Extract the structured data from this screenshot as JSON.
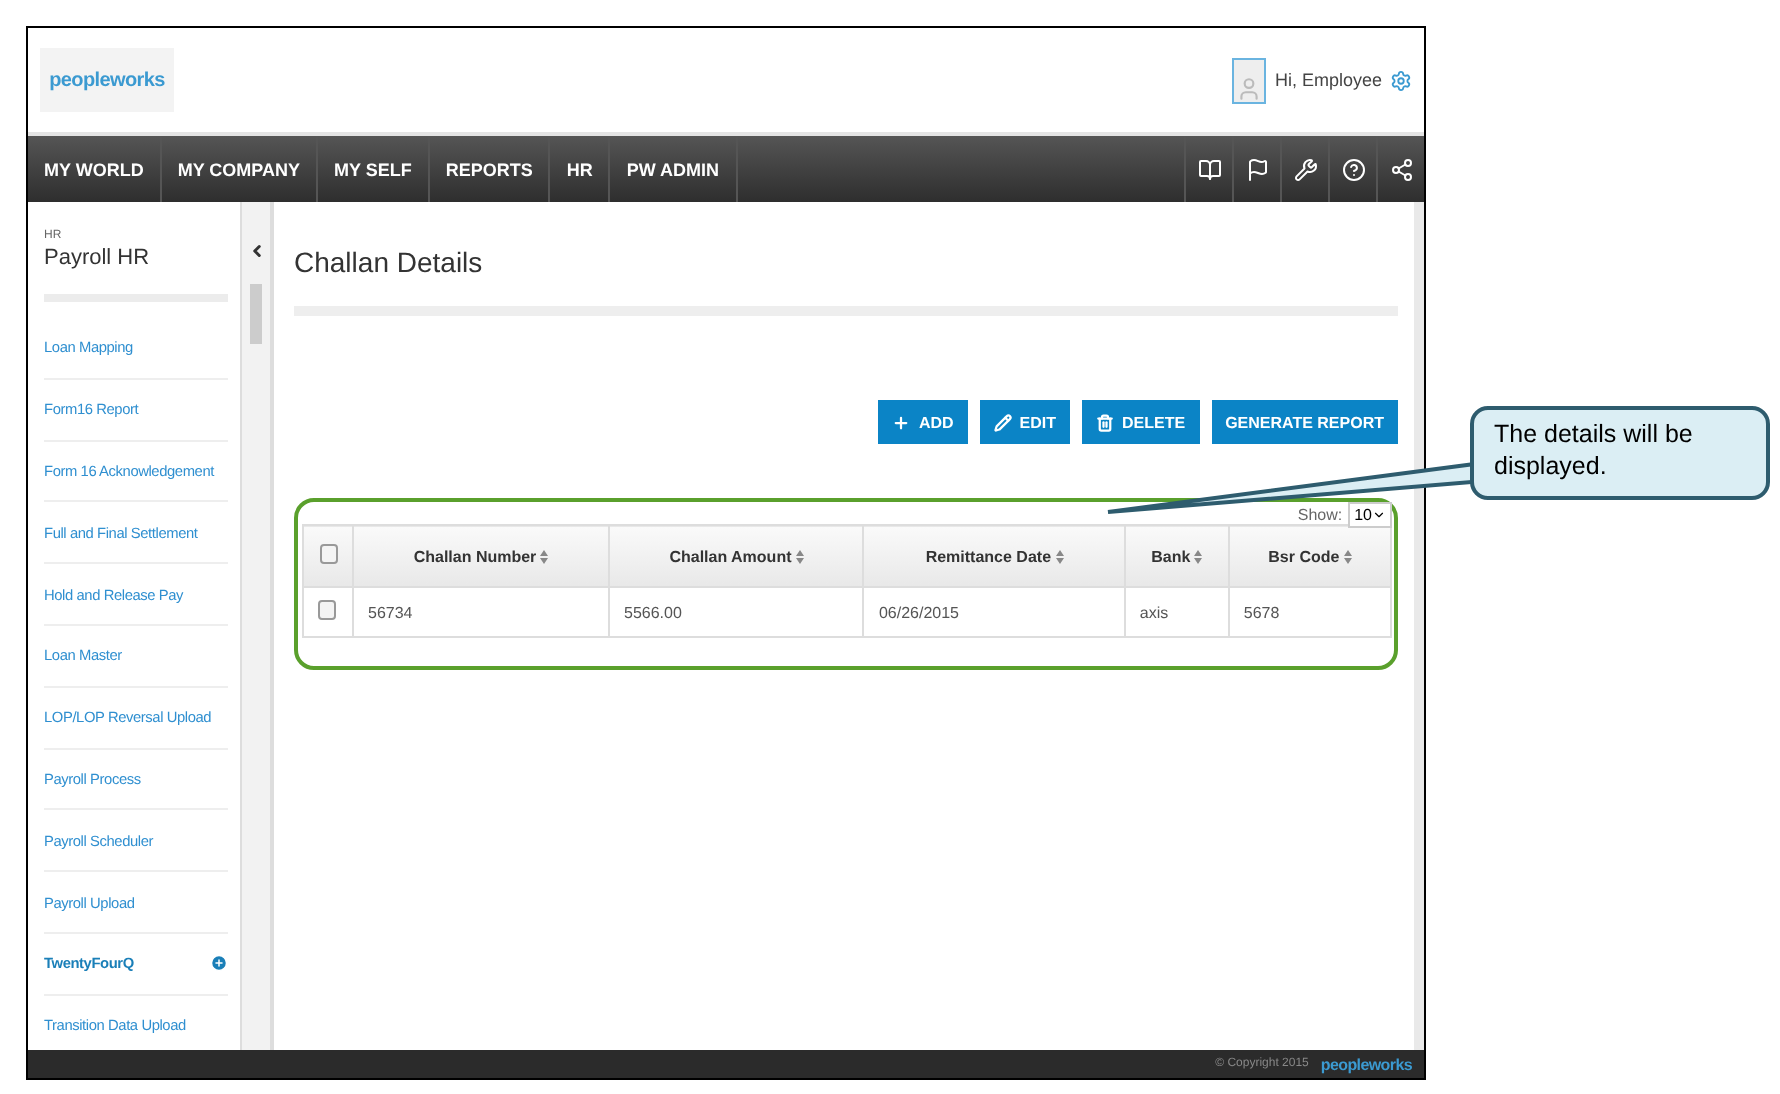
{
  "header": {
    "logo": "peopleworks",
    "greeting": "Hi, Employee"
  },
  "nav": {
    "items": [
      {
        "label": "MY WORLD",
        "selected": false
      },
      {
        "label": "MY COMPANY",
        "selected": false
      },
      {
        "label": "MY SELF",
        "selected": false
      },
      {
        "label": "REPORTS",
        "selected": false
      },
      {
        "label": "HR",
        "selected": false
      },
      {
        "label": "PW ADMIN",
        "selected": false
      }
    ],
    "tools": [
      {
        "kind": "book"
      },
      {
        "kind": "flag"
      },
      {
        "kind": "tools"
      },
      {
        "kind": "help"
      },
      {
        "kind": "share"
      }
    ]
  },
  "sidebar": {
    "section": "HR",
    "title": "Payroll HR",
    "items": [
      {
        "label": "Loan Mapping",
        "selected": false
      },
      {
        "label": "Form16 Report",
        "selected": false
      },
      {
        "label": "Form 16 Acknowledgement",
        "selected": false
      },
      {
        "label": "Full and Final Settlement",
        "selected": false
      },
      {
        "label": "Hold and Release Pay",
        "selected": false
      },
      {
        "label": "Loan Master",
        "selected": false
      },
      {
        "label": "LOP/LOP Reversal Upload",
        "selected": false
      },
      {
        "label": "Payroll Process",
        "selected": false
      },
      {
        "label": "Payroll Scheduler",
        "selected": false
      },
      {
        "label": "Payroll Upload",
        "selected": false
      },
      {
        "label": "TwentyFourQ",
        "selected": true
      },
      {
        "label": "Transition Data Upload",
        "selected": false
      }
    ]
  },
  "main": {
    "title": "Challan Details",
    "buttons": [
      {
        "kind": "add",
        "label": "ADD"
      },
      {
        "kind": "edit",
        "label": "EDIT"
      },
      {
        "kind": "delete",
        "label": "DELETE"
      },
      {
        "kind": "plain",
        "label": "GENERATE REPORT"
      }
    ],
    "show_label": "Show:",
    "page_size": "10",
    "table": {
      "select_all": {
        "checked": false
      },
      "columns": [
        "Challan Number",
        "Challan Amount",
        "Remittance Date",
        "Bank",
        "Bsr Code"
      ],
      "rows": [
        {
          "checked": false,
          "cells": [
            "56734",
            "5566.00",
            "06/26/2015",
            "axis",
            "5678"
          ]
        }
      ]
    }
  },
  "footer": {
    "copyright": "© Copyright 2015",
    "logo": "peopleworks"
  },
  "callout": {
    "text": "The details will be displayed."
  }
}
